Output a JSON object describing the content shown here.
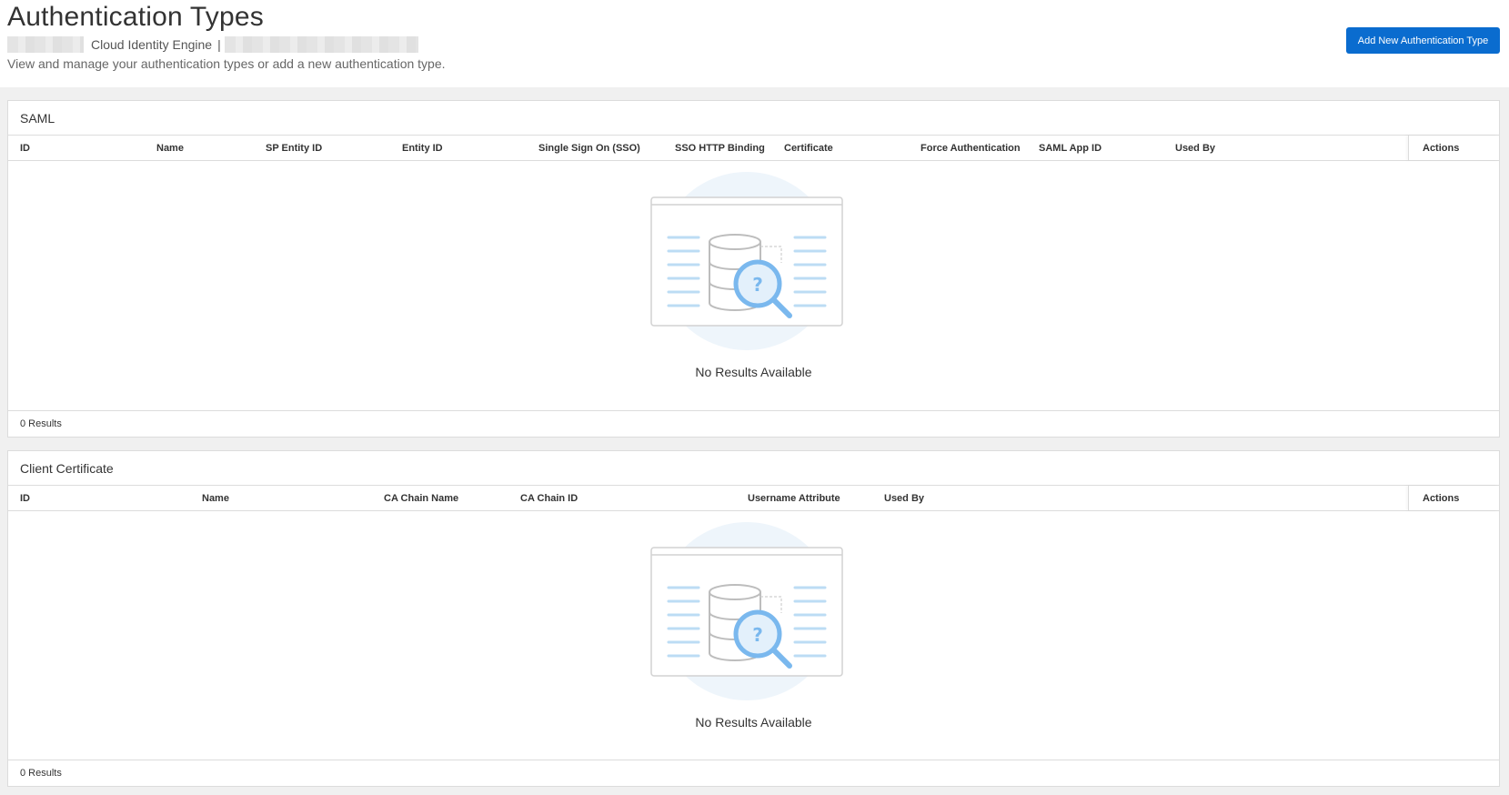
{
  "header": {
    "title": "Authentication Types",
    "tenant_product": "Cloud Identity Engine",
    "tenant_separator": "|",
    "subtitle": "View and manage your authentication types or add a new authentication type.",
    "add_button_label": "Add New Authentication Type",
    "accent_color": "#0a6ccf"
  },
  "saml": {
    "title": "SAML",
    "columns": [
      "ID",
      "Name",
      "SP Entity ID",
      "Entity ID",
      "Single Sign On (SSO)",
      "SSO HTTP Binding",
      "Certificate",
      "Force Authentication",
      "SAML App ID",
      "Used By"
    ],
    "actions_label": "Actions",
    "empty_text": "No Results Available",
    "results_count": "0 Results",
    "empty_icon": "database-search-icon"
  },
  "client_certificate": {
    "title": "Client Certificate",
    "columns": [
      "ID",
      "Name",
      "CA Chain Name",
      "CA Chain ID",
      "Username Attribute",
      "Used By"
    ],
    "actions_label": "Actions",
    "empty_text": "No Results Available",
    "results_count": "0 Results",
    "empty_icon": "database-search-icon"
  }
}
